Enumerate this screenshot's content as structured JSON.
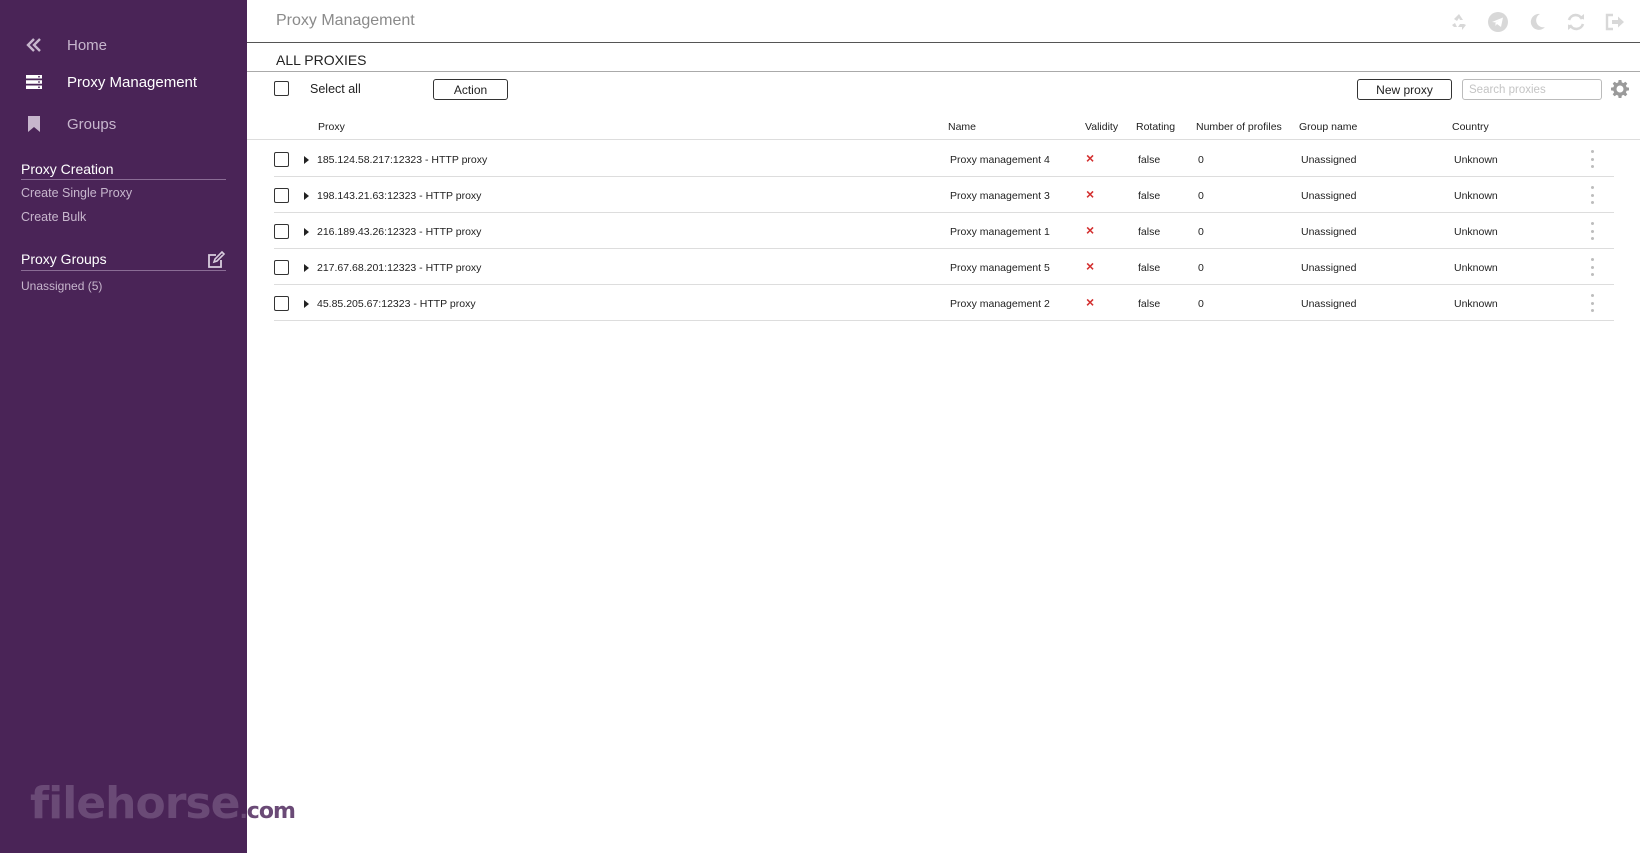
{
  "sidebar": {
    "nav": [
      {
        "label": "Home",
        "icon": "double-chevron-left-icon"
      },
      {
        "label": "Proxy Management",
        "icon": "server-icon"
      },
      {
        "label": "Groups",
        "icon": "bookmark-icon"
      }
    ],
    "proxy_creation": {
      "title": "Proxy Creation",
      "links": [
        "Create Single Proxy",
        "Create Bulk"
      ]
    },
    "proxy_groups": {
      "title": "Proxy Groups",
      "items": [
        "Unassigned (5)"
      ]
    },
    "watermark": {
      "brand": "filehorse",
      "suffix": ".com"
    }
  },
  "header": {
    "title": "Proxy Management",
    "icons": [
      "recycle-icon",
      "telegram-icon",
      "moon-icon",
      "refresh-icon",
      "logout-icon"
    ]
  },
  "main": {
    "section_title": "ALL PROXIES",
    "toolbar": {
      "select_all": "Select all",
      "action": "Action",
      "new_proxy": "New proxy",
      "search_placeholder": "Search proxies"
    },
    "table": {
      "columns": [
        "Proxy",
        "Name",
        "Validity",
        "Rotating",
        "Number of profiles",
        "Group name",
        "Country"
      ],
      "rows": [
        {
          "proxy": "185.124.58.217:12323 - HTTP proxy",
          "name": "Proxy management 4",
          "validity": "×",
          "rotating": "false",
          "profiles": "0",
          "group": "Unassigned",
          "country": "Unknown"
        },
        {
          "proxy": "198.143.21.63:12323 - HTTP proxy",
          "name": "Proxy management 3",
          "validity": "×",
          "rotating": "false",
          "profiles": "0",
          "group": "Unassigned",
          "country": "Unknown"
        },
        {
          "proxy": "216.189.43.26:12323 - HTTP proxy",
          "name": "Proxy management 1",
          "validity": "×",
          "rotating": "false",
          "profiles": "0",
          "group": "Unassigned",
          "country": "Unknown"
        },
        {
          "proxy": "217.67.68.201:12323 - HTTP proxy",
          "name": "Proxy management 5",
          "validity": "×",
          "rotating": "false",
          "profiles": "0",
          "group": "Unassigned",
          "country": "Unknown"
        },
        {
          "proxy": "45.85.205.67:12323 - HTTP proxy",
          "name": "Proxy management 2",
          "validity": "×",
          "rotating": "false",
          "profiles": "0",
          "group": "Unassigned",
          "country": "Unknown"
        }
      ]
    }
  },
  "colors": {
    "sidebar_bg": "#4a2457",
    "invalid_mark": "#d32f2f"
  }
}
